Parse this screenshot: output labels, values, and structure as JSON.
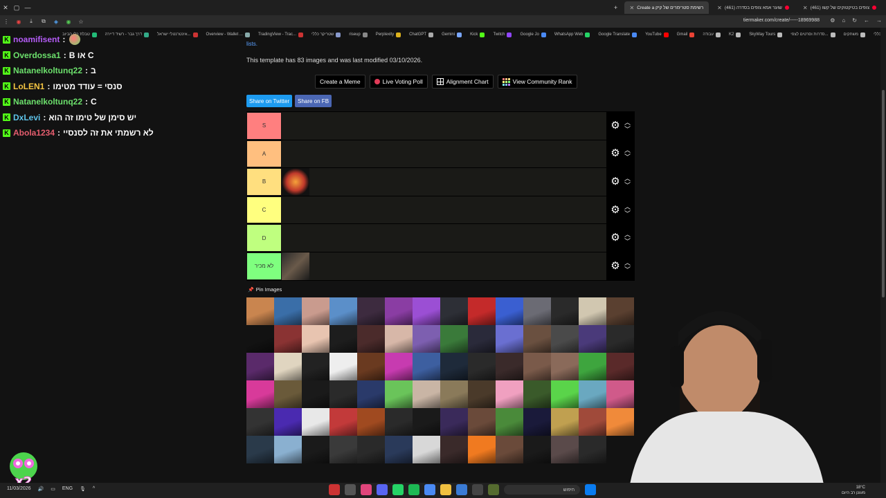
{
  "browser": {
    "tabs": [
      {
        "title": "(461) צופים בטיקטוקים של קשו",
        "active": false
      },
      {
        "title": "(461) שוער אמא צופים בסדרה",
        "active": false
      },
      {
        "title": "Create a רשימת סטרימרים של קיק",
        "active": true
      }
    ],
    "url": "tiermaker.com/create/-----18969988",
    "bookmarks": [
      {
        "label": "טבלת כלי הביוב",
        "color": "#2b7"
      },
      {
        "label": "דרך גבר - רשיד דיירה",
        "color": "#3a8"
      },
      {
        "label": "אינטרנטלי ישראל...",
        "color": "#c33"
      },
      {
        "label": "Overview - Wallet ...",
        "color": "#8aa"
      },
      {
        "label": "TradingView - Trac...",
        "color": "#c33"
      },
      {
        "label": "שטריקר כללי",
        "color": "#89c"
      },
      {
        "label": "riseup",
        "color": "#888"
      },
      {
        "label": "Perplexity",
        "color": "#ddb21d"
      },
      {
        "label": "ChatGPT",
        "color": "#aaa"
      },
      {
        "label": "Gemini",
        "color": "#7aa7ff"
      },
      {
        "label": "Kick",
        "color": "#53fc18"
      },
      {
        "label": "Twitch",
        "color": "#9146ff"
      },
      {
        "label": "Google Jo",
        "color": "#4a8af4"
      },
      {
        "label": "WhatsApp Web",
        "color": "#25d366"
      },
      {
        "label": "Google Translate",
        "color": "#4a8af4"
      },
      {
        "label": "YouTube",
        "color": "#ff0000"
      },
      {
        "label": "Gmail",
        "color": "#ea4335"
      },
      {
        "label": "עבודה",
        "color": "#bbb"
      },
      {
        "label": "K2",
        "color": "#bbb"
      },
      {
        "label": "SkyWay Tours",
        "color": "#bbb"
      },
      {
        "label": "סדרות וסרטים לצפי...",
        "color": "#bbb"
      },
      {
        "label": "משחקים",
        "color": "#bbb"
      },
      {
        "label": "כללי",
        "color": "#bbb"
      }
    ]
  },
  "chat": [
    {
      "user": "noamifisent",
      "color": "#b45cf6",
      "sep": ":",
      "msg": ""
    },
    {
      "user": "Overdossa1",
      "color": "#6ce06c",
      "sep": ":",
      "msg": "B או C"
    },
    {
      "user": "Natanelkoltunq22",
      "color": "#6ce06c",
      "sep": ":",
      "msg": "ב"
    },
    {
      "user": "LoLEN1",
      "color": "#f5c542",
      "sep": ":",
      "msg": "סנסי = עודד מטימו"
    },
    {
      "user": "Natanelkoltunq22",
      "color": "#6ce06c",
      "sep": ":",
      "msg": "C"
    },
    {
      "user": "DxLevi",
      "color": "#5ec4ea",
      "sep": ":",
      "msg": "יש סימן של טימו זה הוא"
    },
    {
      "user": "Abola1234",
      "color": "#e55d6e",
      "sep": ":",
      "msg": "לא רשמתי את זה לסנסיי"
    }
  ],
  "page": {
    "lists_link": "lists.",
    "info": "This template has 83 images and was last modified 03/10/2026.",
    "buttons": {
      "create_meme": "Create a Meme",
      "live_voting": "Live Voting Poll",
      "alignment": "Alignment Chart",
      "community_rank": "View Community Rank"
    },
    "share": {
      "twitter": "Share on Twitter",
      "fb": "Share on FB"
    },
    "pin_label": "Pin Images"
  },
  "tiers": [
    {
      "label": "S",
      "color": "#ff7f7f",
      "items": []
    },
    {
      "label": "A",
      "color": "#ffbf7f",
      "items": []
    },
    {
      "label": "B",
      "color": "#ffdf7f",
      "items": [
        "streamer-logo-tiger"
      ]
    },
    {
      "label": "C",
      "color": "#ffff7f",
      "items": []
    },
    {
      "label": "D",
      "color": "#bfff7f",
      "items": []
    },
    {
      "label": "לא מכיר",
      "color": "#7fff7f",
      "items": [
        "streamer-photo-man"
      ]
    }
  ],
  "pool_colors": [
    "#c9854f",
    "#3a6ea8",
    "#c99b8e",
    "#5b8fc9",
    "#3d2b3f",
    "#8a3da3",
    "#9b4fd4",
    "#2d2f36",
    "#c42a2a",
    "#3a5fd1",
    "#6b6b74",
    "#2a2a2a",
    "#d1c7b0",
    "#5a4030",
    "#121212",
    "#8a3333",
    "#e8c4b0",
    "#1d1d1d",
    "#4b2b2b",
    "#d7b7a8",
    "#7d5fb0",
    "#3a7a3a",
    "#2a2a3a",
    "#6a6fd1",
    "#6a5040",
    "#4a4a4a",
    "#4a3a7a",
    "#2a2a2a",
    "#5a2a6a",
    "#e0d5c0",
    "#222",
    "#eee",
    "#6a3a20",
    "#c73bb0",
    "#3d5fa0",
    "#1e2a3a",
    "#2a2a2a",
    "#3a2a2a",
    "#7a5a4a",
    "#8a6a5a",
    "#3ea53e",
    "#5a2a2a",
    "#d83a9a",
    "#6a5a3a",
    "#1a1a1a",
    "#2a2a2a",
    "#2a3a6a",
    "#6ac45a",
    "#c9b5a5",
    "#8a7a5a",
    "#4a3a2a",
    "#f0a0c0",
    "#3a5a2a",
    "#5ad44a",
    "#6aa8c0",
    "#d05a8a",
    "#333",
    "#4a2ab0",
    "#e8e8e8",
    "#c23a3a",
    "#a04a20",
    "#2a2a2a",
    "#1a1a1a",
    "#3a2a5a",
    "#6a4a3a",
    "#4a8a3a",
    "#1a1a3a",
    "#c0a050",
    "#a04a3a",
    "#f08a3a",
    "#2a3a4a",
    "#8ab0d0",
    "#1a1a1a",
    "#3a3a3a",
    "#2a2a2a",
    "#2a3a5a",
    "#d8d8d8",
    "#3a2a2a",
    "#f07a20",
    "#6a4a3a",
    "#1a1a1a",
    "#5a4a4a",
    "#2a2a2a"
  ],
  "taskbar": {
    "date": "11/03/2026",
    "lang": "ENG",
    "search": "חיפוש",
    "weather": "18°C",
    "weather_desc": "מעונן רב היום"
  }
}
